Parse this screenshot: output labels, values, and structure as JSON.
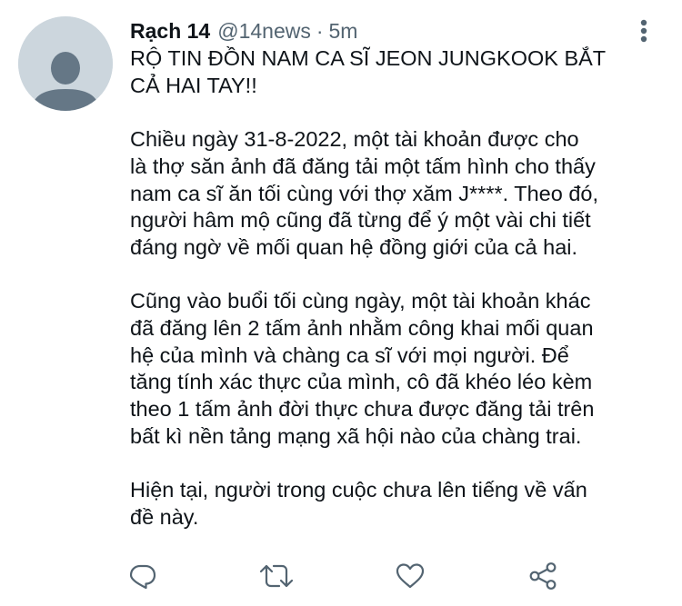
{
  "tweet": {
    "display_name": "Rạch 14",
    "handle": "@14news",
    "separator": "·",
    "time": "5m",
    "paragraphs": [
      "RỘ TIN ĐỒN NAM CA SĨ JEON JUNGKOOK BẮT\nCẢ HAI TAY!!",
      "Chiều ngày 31-8-2022, một tài khoản được cho\nlà thợ săn ảnh đã đăng tải một tấm hình cho thấy\nnam ca sĩ ăn tối cùng với thợ xăm J****. Theo đó,\nngười hâm mộ cũng đã từng để ý một vài chi tiết\nđáng ngờ về mối quan hệ đồng giới của cả hai.",
      "Cũng vào buổi tối cùng ngày, một tài khoản khác\nđã đăng lên 2 tấm ảnh nhằm công khai mối quan\nhệ của mình và chàng ca sĩ với mọi người. Để\ntăng tính xác thực của mình, cô đã khéo léo kèm\ntheo 1 tấm ảnh đời thực chưa được đăng tải trên\nbất kì nền tảng mạng xã hội nào của chàng trai.",
      "Hiện tại, người trong cuộc chưa lên tiếng về vấn\nđề này."
    ]
  },
  "icons": {
    "avatar": "default-avatar-icon",
    "more": "more-vertical-icon",
    "reply": "reply-icon",
    "retweet": "retweet-icon",
    "like": "heart-icon",
    "share": "share-icon"
  },
  "colors": {
    "text": "#0f1419",
    "secondary": "#536471",
    "avatar_bg": "#ccd6dd",
    "avatar_fg": "#657786"
  }
}
